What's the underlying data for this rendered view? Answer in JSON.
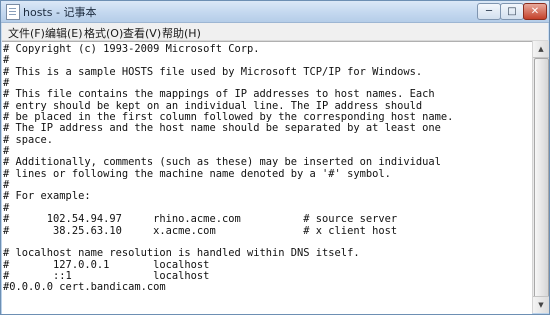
{
  "window": {
    "title": "hosts - 记事本",
    "controls": {
      "minimize": "─",
      "maximize": "□",
      "close": "✕"
    },
    "icon": "notepad-icon"
  },
  "menubar": {
    "items": [
      {
        "label": "文件(F)"
      },
      {
        "label": "编辑(E)"
      },
      {
        "label": "格式(O)"
      },
      {
        "label": "查看(V)"
      },
      {
        "label": "帮助(H)"
      }
    ]
  },
  "editor": {
    "lines": [
      "# Copyright (c) 1993-2009 Microsoft Corp.",
      "#",
      "# This is a sample HOSTS file used by Microsoft TCP/IP for Windows.",
      "#",
      "# This file contains the mappings of IP addresses to host names. Each",
      "# entry should be kept on an individual line. The IP address should",
      "# be placed in the first column followed by the corresponding host name.",
      "# The IP address and the host name should be separated by at least one",
      "# space.",
      "#",
      "# Additionally, comments (such as these) may be inserted on individual",
      "# lines or following the machine name denoted by a '#' symbol.",
      "#",
      "# For example:",
      "#",
      "#      102.54.94.97     rhino.acme.com          # source server",
      "#       38.25.63.10     x.acme.com              # x client host",
      "",
      "# localhost name resolution is handled within DNS itself.",
      "#\t127.0.0.1       localhost",
      "#\t::1             localhost",
      "#0.0.0.0 cert.bandicam.com"
    ]
  },
  "scrollbar": {
    "up_arrow": "▲",
    "down_arrow": "▼"
  }
}
